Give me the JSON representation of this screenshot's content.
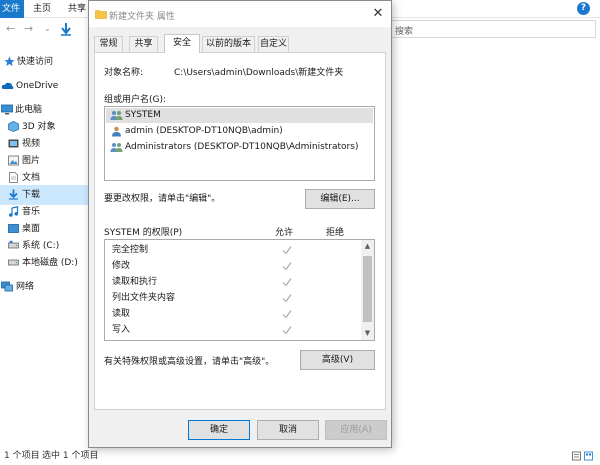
{
  "explorer": {
    "ribbon": {
      "file_tab": "文件",
      "home_tab": "主页",
      "share_tab": "共享"
    },
    "search_placeholder": "搜索",
    "nav_items": [
      {
        "label": "快速访问",
        "icon": "star-icon"
      },
      {
        "label": "OneDrive",
        "icon": "cloud-icon"
      },
      {
        "label": "此电脑",
        "icon": "pc-icon"
      },
      {
        "label": "3D 对象",
        "icon": "cube-icon"
      },
      {
        "label": "视频",
        "icon": "video-icon"
      },
      {
        "label": "图片",
        "icon": "picture-icon"
      },
      {
        "label": "文档",
        "icon": "document-icon"
      },
      {
        "label": "下载",
        "icon": "download-icon",
        "selected": true
      },
      {
        "label": "音乐",
        "icon": "music-icon"
      },
      {
        "label": "桌面",
        "icon": "desktop-icon"
      },
      {
        "label": "系统 (C:)",
        "icon": "drive-icon"
      },
      {
        "label": "本地磁盘 (D:)",
        "icon": "drive-icon"
      },
      {
        "label": "网络",
        "icon": "network-icon"
      }
    ],
    "status": {
      "item_count": "1 个项目",
      "selected": "选中 1 个项目"
    }
  },
  "dialog": {
    "title": "新建文件夹 属性",
    "tabs": [
      "常规",
      "共享",
      "安全",
      "以前的版本",
      "自定义"
    ],
    "active_tab": "安全",
    "object_name_label": "对象名称:",
    "object_name_value": "C:\\Users\\admin\\Downloads\\新建文件夹",
    "groups_label": "组或用户名(G):",
    "users": [
      {
        "name": "SYSTEM",
        "selected": true
      },
      {
        "name": "admin (DESKTOP-DT10NQB\\admin)",
        "selected": false
      },
      {
        "name": "Administrators (DESKTOP-DT10NQB\\Administrators)",
        "selected": false
      }
    ],
    "edit_hint": "要更改权限，请单击\"编辑\"。",
    "edit_button": "编辑(E)...",
    "perm_header": "SYSTEM 的权限(P)",
    "allow_header": "允许",
    "deny_header": "拒绝",
    "permissions": [
      {
        "name": "完全控制",
        "allow": true,
        "deny": false
      },
      {
        "name": "修改",
        "allow": true,
        "deny": false
      },
      {
        "name": "读取和执行",
        "allow": true,
        "deny": false
      },
      {
        "name": "列出文件夹内容",
        "allow": true,
        "deny": false
      },
      {
        "name": "读取",
        "allow": true,
        "deny": false
      },
      {
        "name": "写入",
        "allow": true,
        "deny": false
      }
    ],
    "advanced_hint": "有关特殊权限或高级设置，请单击\"高级\"。",
    "advanced_button": "高级(V)",
    "ok_button": "确定",
    "cancel_button": "取消",
    "apply_button": "应用(A)"
  },
  "colors": {
    "accent": "#1979ca",
    "selection": "#cce8ff",
    "checkmark": "#a8a8a8"
  }
}
